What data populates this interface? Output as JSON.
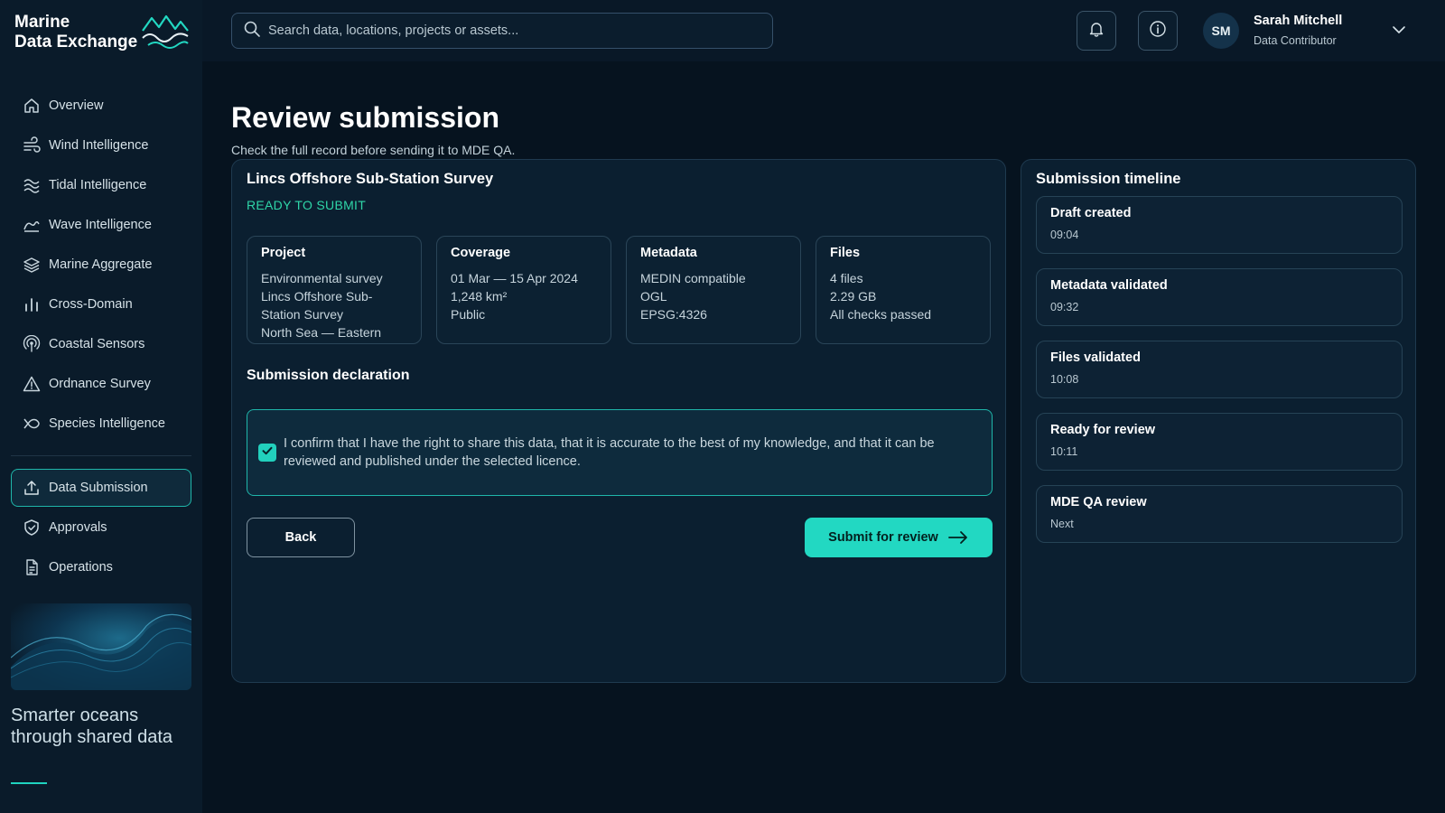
{
  "brand": {
    "line1": "Marine",
    "line2": "Data Exchange",
    "tagline": "Smarter oceans through shared data",
    "accent": "#22d8c2"
  },
  "sidebar": {
    "items": [
      {
        "label": "Overview",
        "icon": "home-icon"
      },
      {
        "label": "Wind Intelligence",
        "icon": "wind-icon"
      },
      {
        "label": "Tidal Intelligence",
        "icon": "tide-icon"
      },
      {
        "label": "Wave Intelligence",
        "icon": "wave-icon"
      },
      {
        "label": "Marine Aggregate",
        "icon": "layers-icon"
      },
      {
        "label": "Cross-Domain",
        "icon": "bars-icon"
      },
      {
        "label": "Coastal Sensors",
        "icon": "sensor-icon"
      },
      {
        "label": "Ordnance Survey",
        "icon": "warning-icon"
      },
      {
        "label": "Species Intelligence",
        "icon": "fish-icon"
      }
    ],
    "secondary": [
      {
        "label": "Data Submission",
        "icon": "upload-icon",
        "active": true
      },
      {
        "label": "Approvals",
        "icon": "shield-check-icon"
      },
      {
        "label": "Operations",
        "icon": "document-icon"
      }
    ]
  },
  "topbar": {
    "search_placeholder": "Search data, locations, projects or assets...",
    "user_initials": "SM",
    "user_name": "Sarah Mitchell",
    "user_role": "Data Contributor"
  },
  "page": {
    "title": "Review submission",
    "subtitle": "Check the full record before sending it to MDE QA."
  },
  "submission": {
    "title": "Lincs Offshore Sub-Station Survey",
    "status": "READY TO SUBMIT",
    "boxes": [
      {
        "label": "Project",
        "lines": [
          "Environmental survey",
          "Lincs Offshore Sub-",
          "Station Survey",
          "North Sea — Eastern"
        ]
      },
      {
        "label": "Coverage",
        "lines": [
          "01 Mar — 15 Apr 2024",
          "1,248 km²",
          "Public"
        ]
      },
      {
        "label": "Metadata",
        "lines": [
          "MEDIN compatible",
          "OGL",
          "EPSG:4326"
        ]
      },
      {
        "label": "Files",
        "lines": [
          "4 files",
          "2.29 GB",
          "All checks passed"
        ]
      }
    ],
    "declaration_title": "Submission declaration",
    "declaration_text": "I confirm that I have the right to share this data, that it is accurate to the best of my knowledge, and that it can be reviewed and published under the selected licence.",
    "declaration_checked": true,
    "back_label": "Back",
    "submit_label": "Submit for review"
  },
  "timeline": {
    "title": "Submission timeline",
    "items": [
      {
        "title": "Draft created",
        "time": "09:04"
      },
      {
        "title": "Metadata validated",
        "time": "09:32"
      },
      {
        "title": "Files validated",
        "time": "10:08"
      },
      {
        "title": "Ready for review",
        "time": "10:11"
      },
      {
        "title": "MDE QA review",
        "time": "Next"
      }
    ]
  }
}
